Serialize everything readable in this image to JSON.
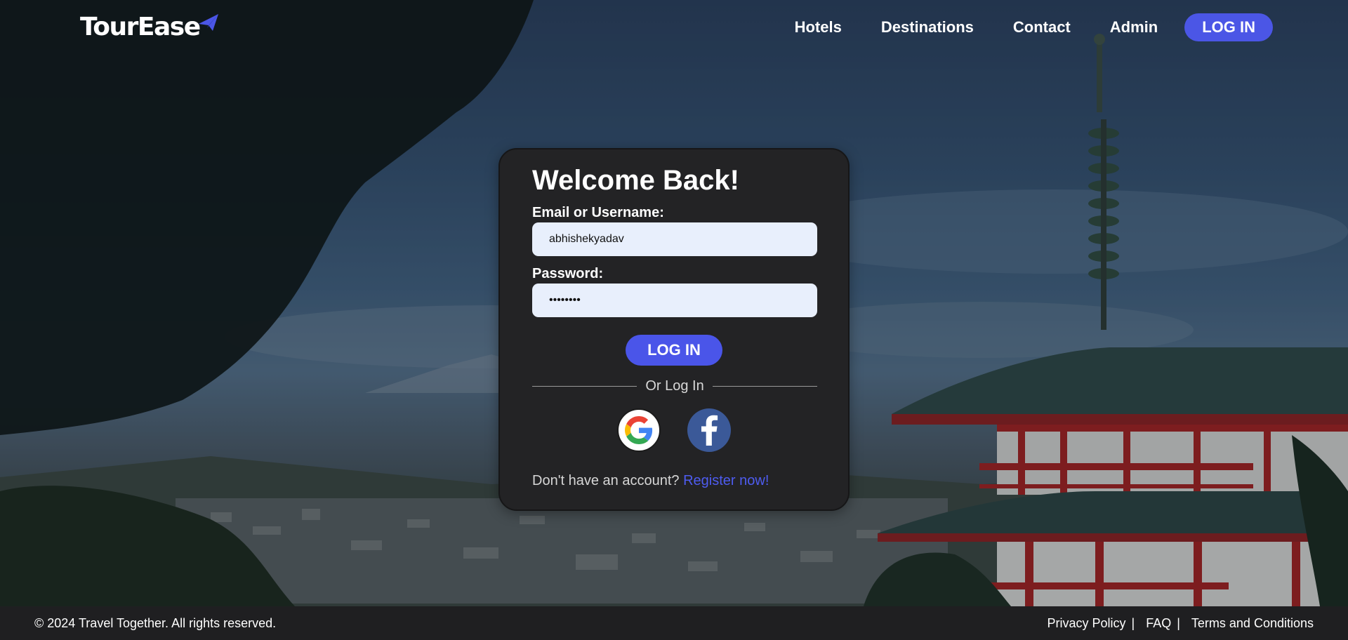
{
  "brand": {
    "name": "TourEase",
    "accent": "#4b56e6"
  },
  "nav": {
    "items": [
      "Hotels",
      "Destinations",
      "Contact",
      "Admin"
    ],
    "login_label": "LOG IN"
  },
  "login_card": {
    "title": "Welcome Back!",
    "email_label": "Email or Username:",
    "email_value": "abhishekyadav",
    "password_label": "Password:",
    "password_value": "••••••••",
    "submit_label": "LOG IN",
    "divider_text": "Or Log In",
    "social": [
      "google-icon",
      "facebook-icon"
    ],
    "register_prompt": "Don't have an account?",
    "register_link": "Register now!"
  },
  "footer": {
    "copyright": "© 2024 Travel Together. All rights reserved.",
    "links": [
      "Privacy Policy",
      "FAQ",
      "Terms and Conditions"
    ],
    "separator": "|"
  },
  "colors": {
    "card_bg": "#232325",
    "input_bg": "#e8effc",
    "button": "#4a55e9",
    "link": "#4e5cf0",
    "footer_bg": "#1f1f21"
  }
}
